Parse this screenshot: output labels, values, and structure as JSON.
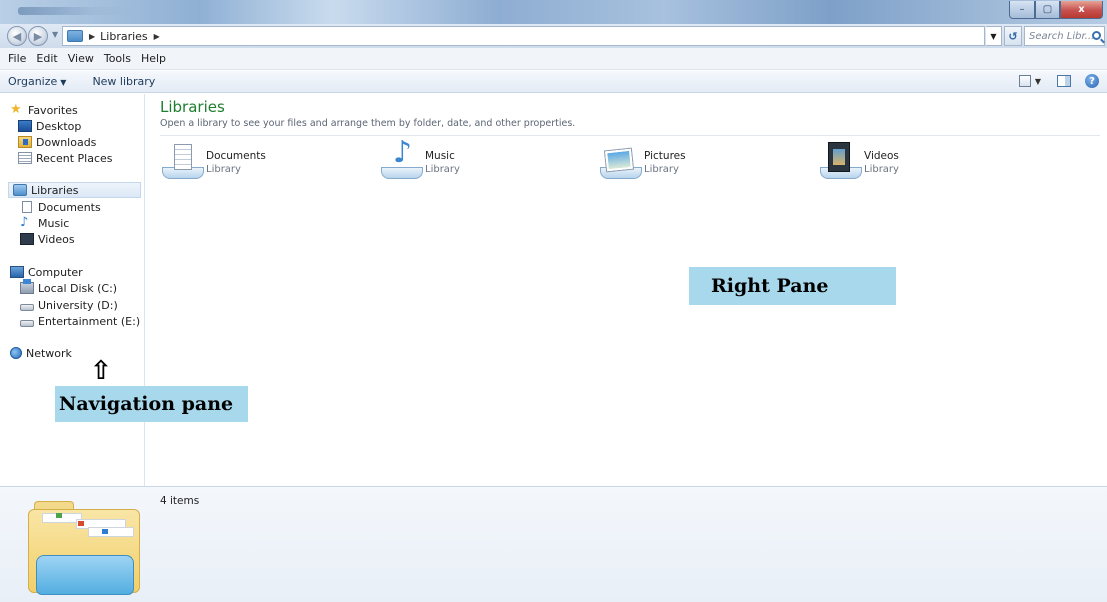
{
  "window": {
    "controls": {
      "minimize": "–",
      "maximize": "▢",
      "close": "x"
    }
  },
  "address": {
    "breadcrumb": [
      "Libraries"
    ],
    "search_placeholder": "Search Libr..."
  },
  "menu": [
    "File",
    "Edit",
    "View",
    "Tools",
    "Help"
  ],
  "toolbar": {
    "organize_label": "Organize",
    "new_library_label": "New library"
  },
  "nav": {
    "favorites": {
      "label": "Favorites",
      "items": [
        "Desktop",
        "Downloads",
        "Recent Places"
      ]
    },
    "libraries": {
      "label": "Libraries",
      "items": [
        "Documents",
        "Music",
        "Videos"
      ]
    },
    "computer": {
      "label": "Computer",
      "items": [
        "Local Disk (C:)",
        "University (D:)",
        "Entertainment (E:)"
      ]
    },
    "network": {
      "label": "Network"
    }
  },
  "annotations": {
    "navigation_pane": "Navigation pane",
    "right_pane": "Right Pane"
  },
  "content": {
    "title": "Libraries",
    "subtitle": "Open a library to see your files and arrange them by folder, date, and other properties.",
    "libraries": [
      {
        "name": "Documents",
        "kind": "Library",
        "icon": "documents-library-icon"
      },
      {
        "name": "Music",
        "kind": "Library",
        "icon": "music-library-icon"
      },
      {
        "name": "Pictures",
        "kind": "Library",
        "icon": "pictures-library-icon"
      },
      {
        "name": "Videos",
        "kind": "Library",
        "icon": "videos-library-icon"
      }
    ]
  },
  "details": {
    "count": "4 items"
  },
  "colors": {
    "title_green": "#1e7d2f",
    "callout_bg": "#a8d8ec",
    "selection": "#dbe8f6"
  }
}
